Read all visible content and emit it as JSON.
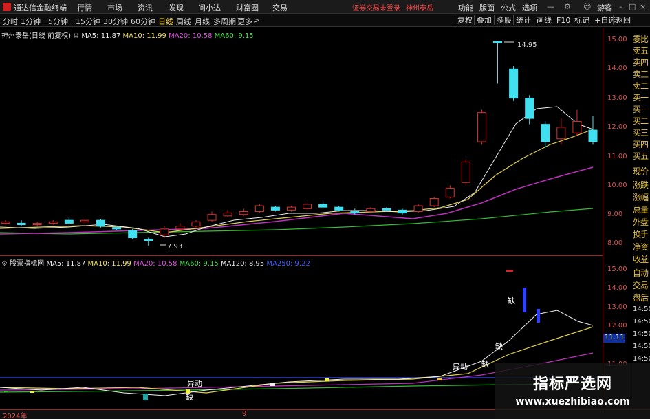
{
  "menubar": {
    "app_title": "通达信金融终端",
    "items": [
      "行情",
      "市场",
      "资讯",
      "发现",
      "问小达",
      "财富圈",
      "交易"
    ],
    "warning": "证券交易未登录",
    "stock_name": "神州泰岳",
    "right_items": [
      "功能",
      "版面",
      "公式",
      "选项",
      "游客"
    ]
  },
  "periodbar": {
    "periods": [
      "分时",
      "1分钟",
      "5分钟",
      "15分钟",
      "30分钟",
      "60分钟",
      "日线",
      "周线",
      "月线",
      "多周期",
      "更多"
    ],
    "active": "日线",
    "tools": [
      "复权",
      "叠加",
      "多股",
      "统计",
      "画线",
      "F10",
      "标记",
      "+自选",
      "返回"
    ]
  },
  "main_chart": {
    "title": "神州泰岳(日线 前复权)",
    "ma5": "MA5: 11.87",
    "ma10": "MA10: 11.99",
    "ma20": "MA20: 10.58",
    "ma60": "MA60: 9.15",
    "high_label": "14.95",
    "low_label": "7.93",
    "y_ticks": [
      "15.00",
      "14.00",
      "13.00",
      "12.00",
      "11.00",
      "10.00",
      "9.00",
      "8.00"
    ]
  },
  "sub_chart": {
    "title": "股票指标网",
    "ma5": "MA5: 11.87",
    "ma10": "MA10: 11.99",
    "ma20": "MA20: 10.58",
    "ma60": "MA60: 9.15",
    "ma120": "MA120: 8.95",
    "ma250": "MA250: 9.22",
    "labels": {
      "yidong1": "异动",
      "yidong2": "异动",
      "que1": "缺",
      "que2": "缺",
      "que3": "缺",
      "que4": "缺"
    },
    "y_ticks": [
      "15.00",
      "14.00",
      "13.00",
      "12.00",
      "11.00"
    ],
    "price_box": "11.11",
    "time_ticks": [
      "14:50",
      "14:50",
      "14:50",
      "14:50",
      "14:50"
    ]
  },
  "sidepanel": {
    "items": [
      "委比",
      "卖五",
      "卖四",
      "卖三",
      "卖二",
      "卖一",
      "买一",
      "买二",
      "买三",
      "买四",
      "买五",
      "现价",
      "涨跌",
      "涨幅",
      "总量",
      "外盘",
      "换手",
      "净资",
      "收益",
      "自动",
      "交易",
      "盘后"
    ]
  },
  "bottombar": {
    "year": "2024年",
    "month": "9"
  },
  "watermark": {
    "line1": "指标严选网",
    "line2": "www.xuezhibiao.com"
  }
}
